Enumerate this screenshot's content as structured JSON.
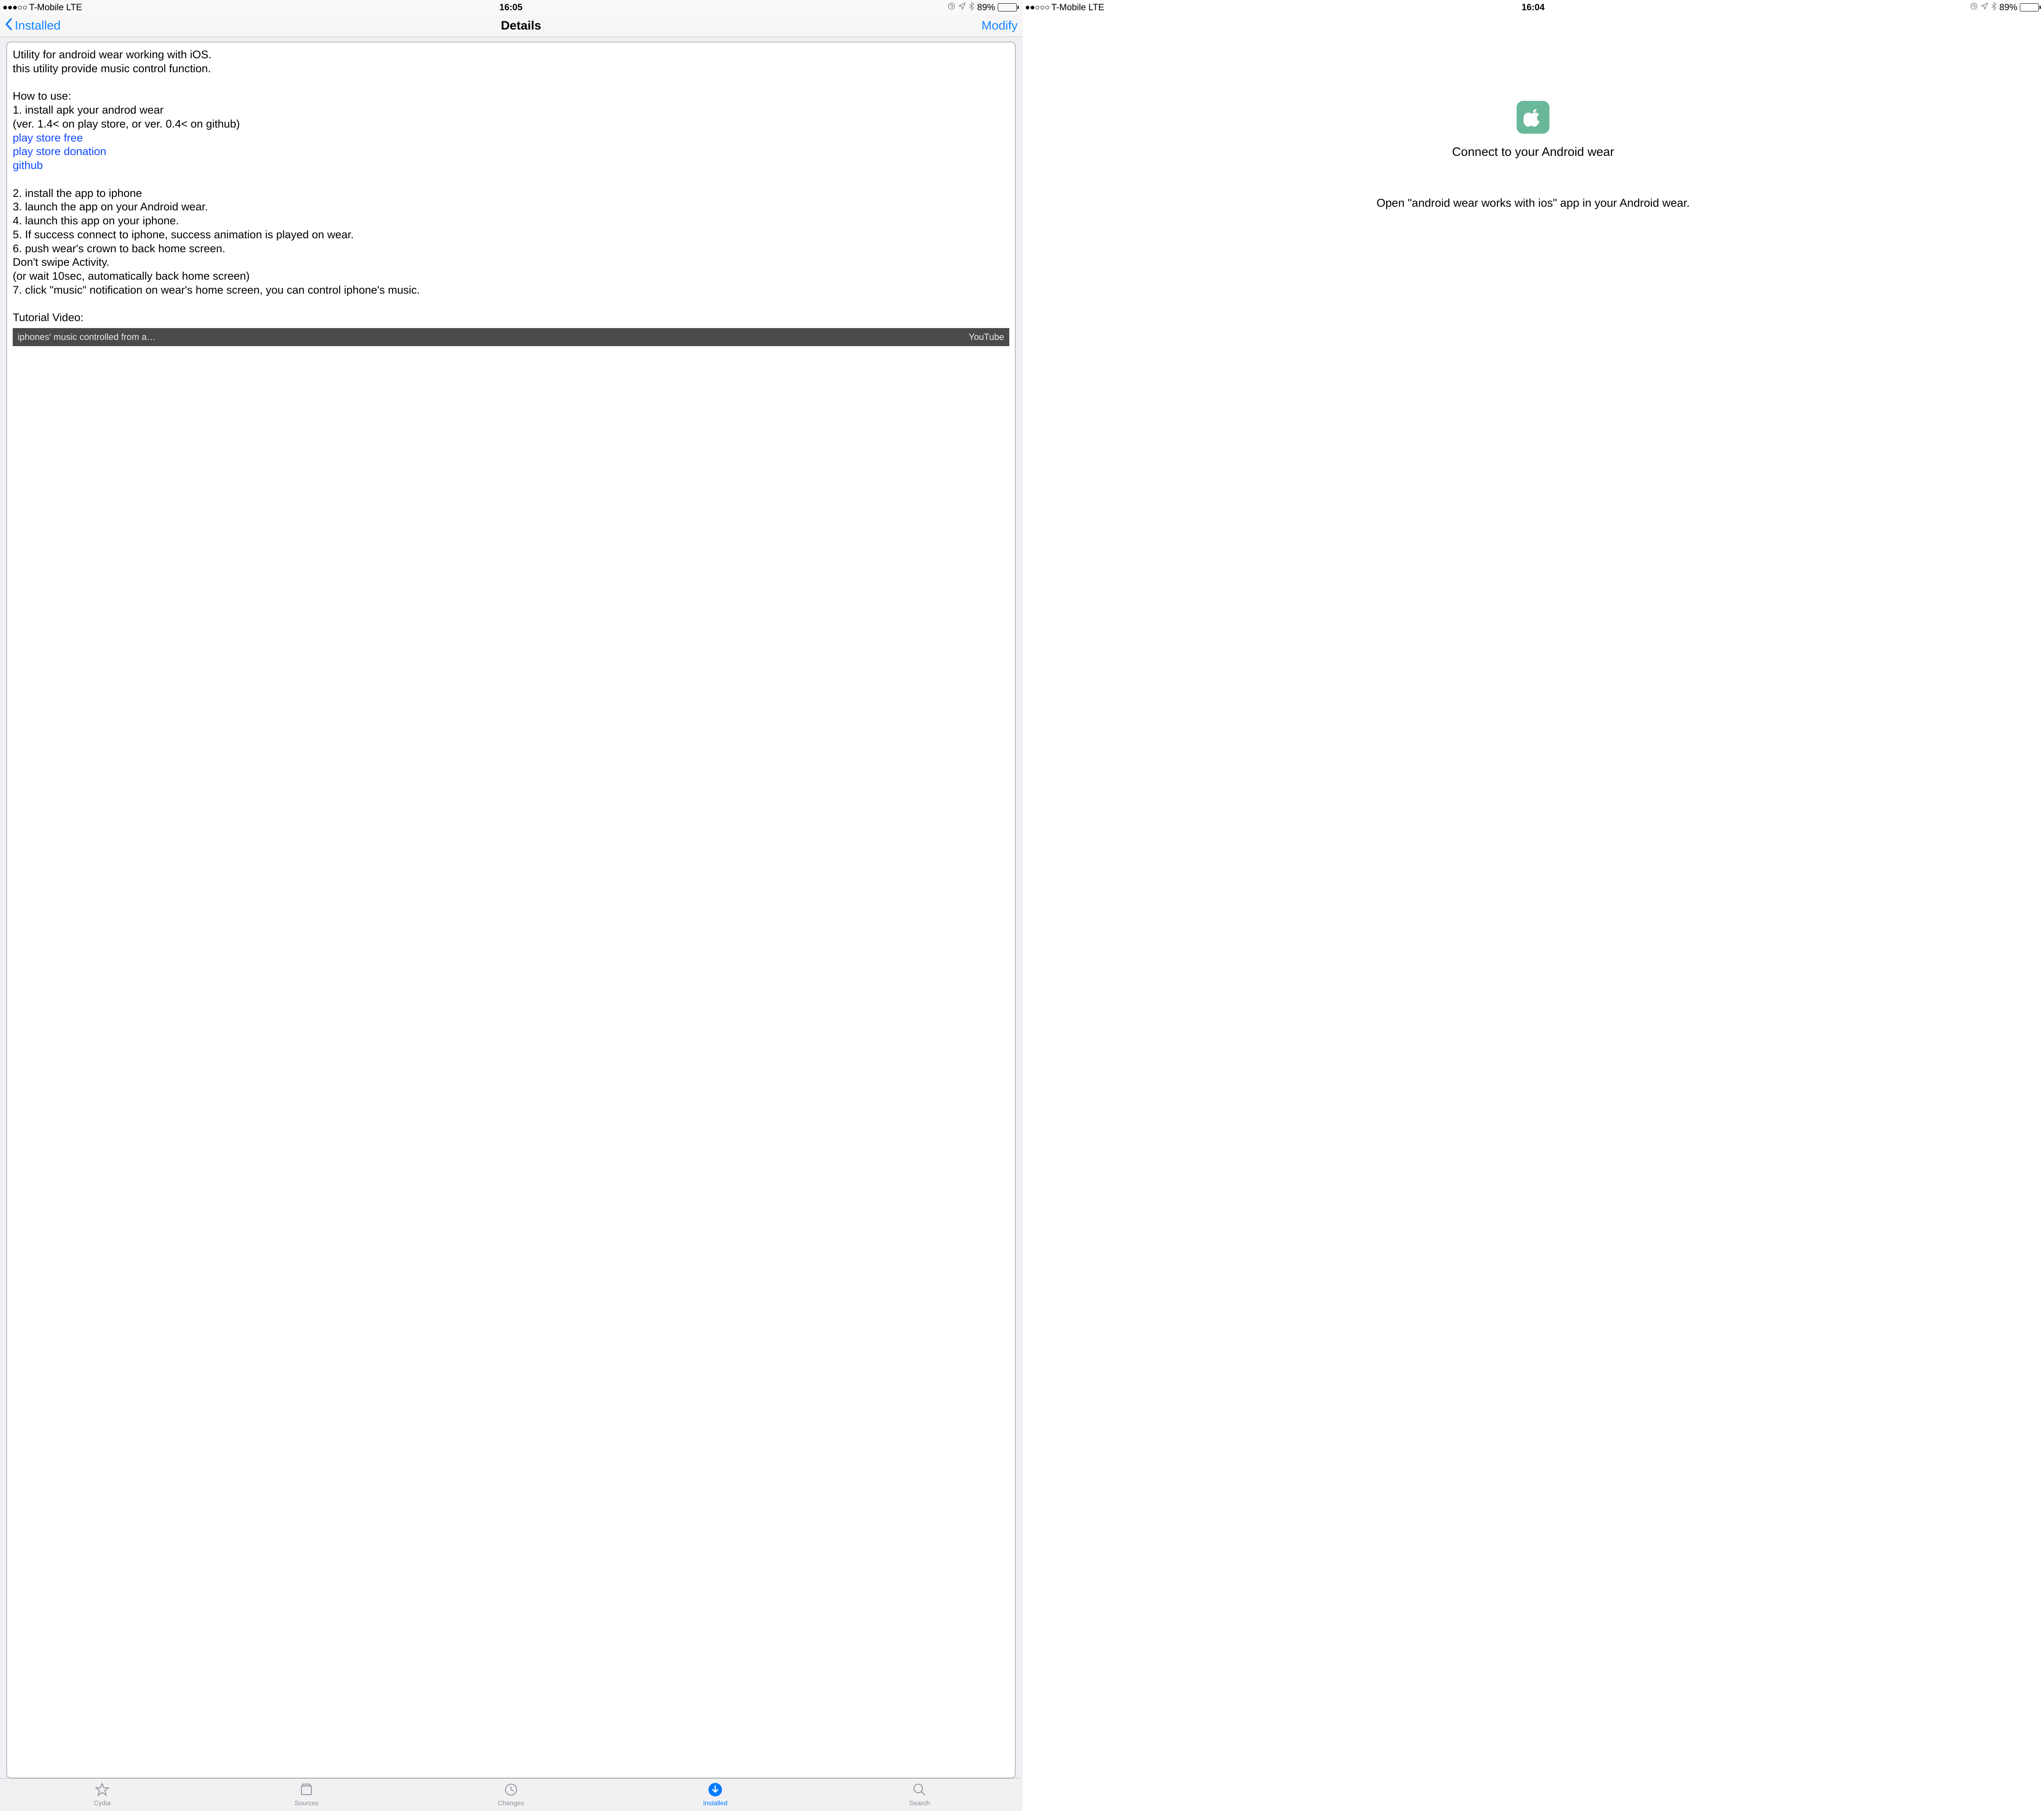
{
  "left": {
    "status": {
      "carrier": "T-Mobile",
      "net": "LTE",
      "time": "16:05",
      "battery_pct": "89%",
      "battery_fill_pct": 89,
      "signal_dots_filled": 3
    },
    "nav": {
      "back": "Installed",
      "title": "Details",
      "action": "Modify"
    },
    "card": {
      "intro1": "Utility for android wear working with iOS.",
      "intro2": "this utility provide music control function.",
      "howto_label": "How to use:",
      "step1a": "1. install apk your androd wear",
      "step1b": "(ver. 1.4< on play store, or ver. 0.4< on github)",
      "link1": "play store free",
      "link2": "play store donation",
      "link3": "github",
      "step2": "2. install the app to iphone",
      "step3": "3. launch the app on your Android wear.",
      "step4": "4. launch this app on your iphone.",
      "step5": "5. If success connect to iphone, success animation is played on wear.",
      "step6": "6. push wear's crown to back home screen.",
      "step6b": "Don't swipe Activity.",
      "step6c": "(or wait 10sec, automatically back home screen)",
      "step7": "7. click \"music\" notification on wear's home screen, you can control iphone's music.",
      "tutorial_label": "Tutorial Video:",
      "video_title": "iphones' music controlled from a…",
      "video_source": "YouTube"
    },
    "tabs": {
      "cydia": "Cydia",
      "sources": "Sources",
      "changes": "Changes",
      "installed": "Installed",
      "search": "Search"
    }
  },
  "right": {
    "status": {
      "carrier": "T-Mobile",
      "net": "LTE",
      "time": "16:04",
      "battery_pct": "89%",
      "battery_fill_pct": 89,
      "signal_dots_filled": 2
    },
    "title": "Connect to your Android wear",
    "sub": "Open \"android wear works with ios\" app in your Android wear."
  }
}
